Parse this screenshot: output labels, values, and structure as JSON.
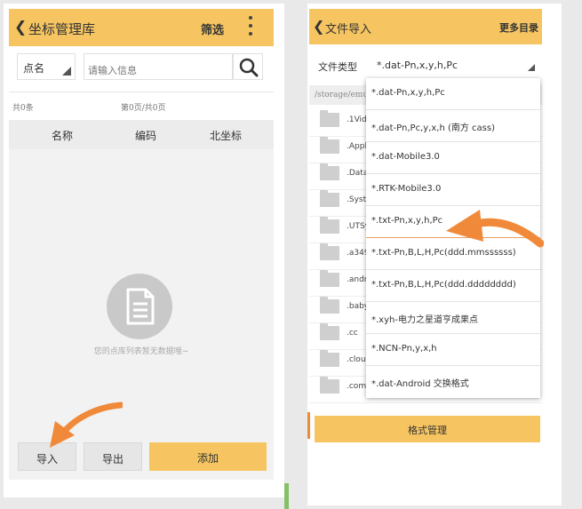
{
  "left": {
    "title": "坐标管理库",
    "filter": "筛选",
    "dropdown": "点名",
    "search_placeholder": "请输入信息",
    "total": "共0条",
    "pages": "第0页/共0页",
    "columns": [
      "名称",
      "编码",
      "北坐标"
    ],
    "empty_msg": "您的点库列表暂无数据哦~",
    "buttons": {
      "import": "导入",
      "export": "导出",
      "add": "添加"
    }
  },
  "right": {
    "title": "文件导入",
    "more": "更多目录",
    "type_label": "文件类型",
    "type_value": "*.dat-Pn,x,y,h,Pc",
    "path": "/storage/emu",
    "files": [
      ".1Vid",
      ".Appl",
      ".DataS",
      ".Syste",
      ".UTSy",
      ".a349",
      ".andro",
      ".baby",
      ".cc",
      ".cloud",
      ".com"
    ],
    "options": [
      "*.dat-Pn,x,y,h,Pc",
      "*.dat-Pn,Pc,y,x,h (南方 cass)",
      "*.dat-Mobile3.0",
      "*.RTK-Mobile3.0",
      "*.txt-Pn,x,y,h,Pc",
      "*.txt-Pn,B,L,H,Pc(ddd.mmssssss)",
      "*.txt-Pn,B,L,H,Pc(ddd.dddddddd)",
      "*.xyh-电力之星道亨成果点",
      "*.NCN-Pn,y,x,h",
      "*.dat-Android 交换格式"
    ],
    "format_button": "格式管理"
  },
  "colors": {
    "accent": "#f6c561",
    "arrow": "#f08a3a"
  }
}
